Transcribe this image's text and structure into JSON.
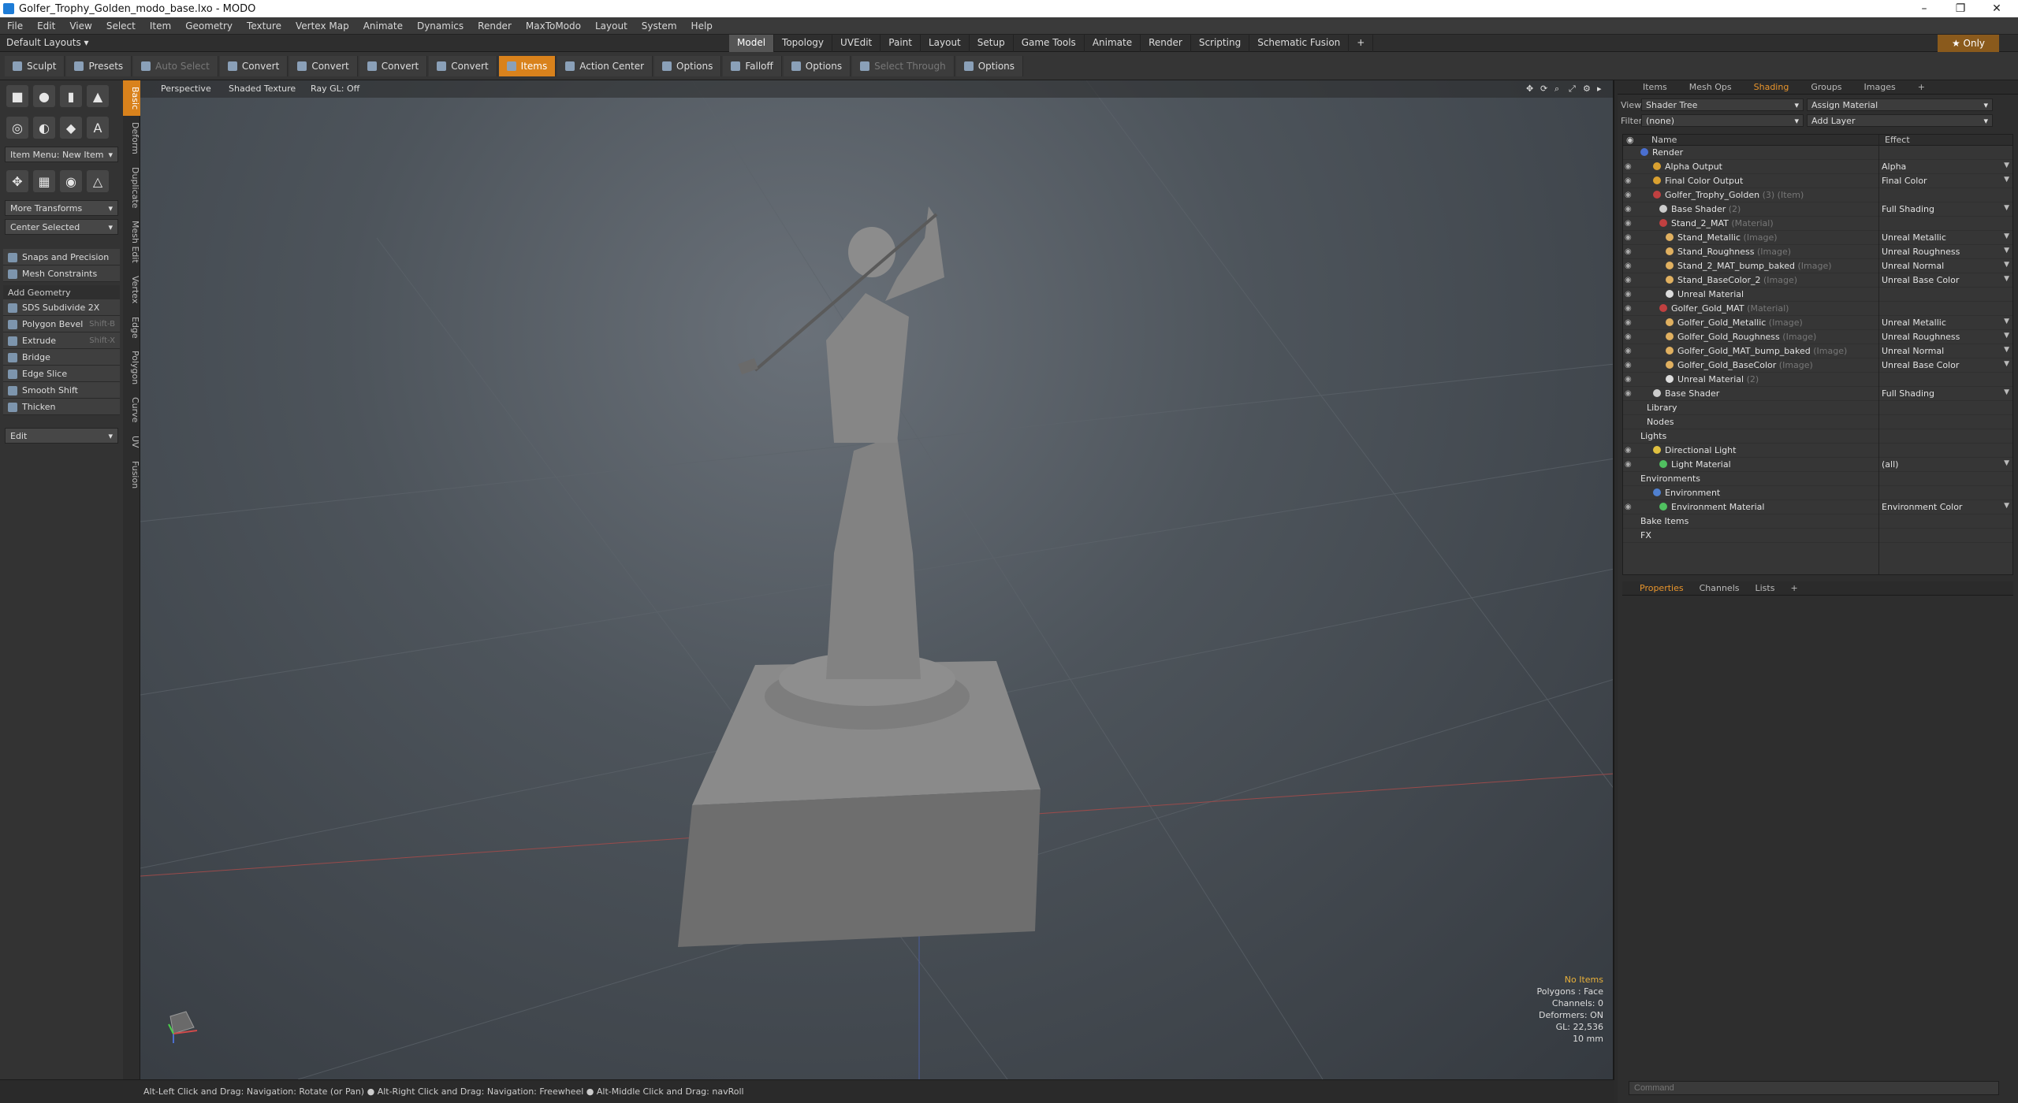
{
  "window": {
    "title": "Golfer_Trophy_Golden_modo_base.lxo - MODO",
    "minimize": "–",
    "maximize": "❐",
    "close": "✕"
  },
  "menu": [
    "File",
    "Edit",
    "View",
    "Select",
    "Item",
    "Geometry",
    "Texture",
    "Vertex Map",
    "Animate",
    "Dynamics",
    "Render",
    "MaxToModo",
    "Layout",
    "System",
    "Help"
  ],
  "layouts": {
    "current": "Default Layouts ▾",
    "tabs": [
      "Model",
      "Topology",
      "UVEdit",
      "Paint",
      "Layout",
      "Setup",
      "Game Tools",
      "Animate",
      "Render",
      "Scripting",
      "Schematic Fusion"
    ],
    "add": "+",
    "only": "★ Only"
  },
  "toolbar": {
    "sculpt": "Sculpt",
    "presets": "Presets",
    "auto_select": "Auto Select",
    "convert1": "Convert",
    "convert2": "Convert",
    "convert3": "Convert",
    "convert4": "Convert",
    "items": "Items",
    "action_center": "Action Center",
    "options1": "Options",
    "falloff": "Falloff",
    "options2": "Options",
    "select_through": "Select Through",
    "options3": "Options"
  },
  "left": {
    "item_menu": "Item Menu: New Item",
    "more_transforms": "More Transforms",
    "center_selected": "Center Selected",
    "snaps": "Snaps and Precision",
    "mesh_constraints": "Mesh Constraints",
    "add_geometry": "Add Geometry",
    "tools": [
      {
        "label": "SDS Subdivide 2X",
        "shortcut": ""
      },
      {
        "label": "Polygon Bevel",
        "shortcut": "Shift-B"
      },
      {
        "label": "Extrude",
        "shortcut": "Shift-X"
      },
      {
        "label": "Bridge",
        "shortcut": ""
      },
      {
        "label": "Edge Slice",
        "shortcut": ""
      },
      {
        "label": "Smooth Shift",
        "shortcut": ""
      },
      {
        "label": "Thicken",
        "shortcut": ""
      }
    ],
    "edit": "Edit",
    "vtabs": [
      "Basic",
      "Deform",
      "Duplicate",
      "Mesh Edit",
      "Vertex",
      "Edge",
      "Polygon",
      "Curve",
      "UV",
      "Fusion"
    ]
  },
  "viewport": {
    "perspective": "Perspective",
    "shading": "Shaded Texture",
    "raygl": "Ray GL: Off",
    "info": [
      "No Items",
      "Polygons : Face",
      "Channels: 0",
      "Deformers: ON",
      "GL: 22,536",
      "10 mm"
    ]
  },
  "status": "Alt-Left Click and Drag: Navigation: Rotate (or Pan) ● Alt-Right Click and Drag: Navigation: Freewheel ● Alt-Middle Click and Drag: navRoll",
  "right": {
    "tabs": [
      "Items",
      "Mesh Ops",
      "Shading",
      "Groups",
      "Images",
      "+"
    ],
    "view_label": "View",
    "view_value": "Shader Tree",
    "assign": "Assign Material",
    "filter_label": "Filter",
    "filter_value": "(none)",
    "add_layer": "Add Layer",
    "col_name": "Name",
    "col_effect": "Effect",
    "tree": [
      {
        "name": "Render",
        "sub": "",
        "effect": "",
        "indent": 0,
        "color": "#4a6fd0",
        "eye": false
      },
      {
        "name": "Alpha Output",
        "sub": "",
        "effect": "Alpha",
        "indent": 2,
        "color": "#d9a030",
        "eye": true
      },
      {
        "name": "Final Color Output",
        "sub": "",
        "effect": "Final Color",
        "indent": 2,
        "color": "#d9a030",
        "eye": true
      },
      {
        "name": "Golfer_Trophy_Golden",
        "sub": "(3) (Item)",
        "effect": "",
        "indent": 2,
        "color": "#c04040",
        "eye": true
      },
      {
        "name": "Base Shader",
        "sub": "(2)",
        "effect": "Full Shading",
        "indent": 3,
        "color": "#cccccc",
        "eye": true
      },
      {
        "name": "Stand_2_MAT",
        "sub": "(Material)",
        "effect": "",
        "indent": 3,
        "color": "#c04040",
        "eye": true
      },
      {
        "name": "Stand_Metallic",
        "sub": "(Image)",
        "effect": "Unreal Metallic",
        "indent": 4,
        "color": "#e0b060",
        "eye": true
      },
      {
        "name": "Stand_Roughness",
        "sub": "(Image)",
        "effect": "Unreal Roughness",
        "indent": 4,
        "color": "#e0b060",
        "eye": true
      },
      {
        "name": "Stand_2_MAT_bump_baked",
        "sub": "(Image)",
        "effect": "Unreal Normal",
        "indent": 4,
        "color": "#e0b060",
        "eye": true
      },
      {
        "name": "Stand_BaseColor_2",
        "sub": "(Image)",
        "effect": "Unreal Base Color",
        "indent": 4,
        "color": "#e0b060",
        "eye": true
      },
      {
        "name": "Unreal Material",
        "sub": "",
        "effect": "",
        "indent": 4,
        "color": "#dddddd",
        "eye": true
      },
      {
        "name": "Golfer_Gold_MAT",
        "sub": "(Material)",
        "effect": "",
        "indent": 3,
        "color": "#c04040",
        "eye": true
      },
      {
        "name": "Golfer_Gold_Metallic",
        "sub": "(Image)",
        "effect": "Unreal Metallic",
        "indent": 4,
        "color": "#e0b060",
        "eye": true
      },
      {
        "name": "Golfer_Gold_Roughness",
        "sub": "(Image)",
        "effect": "Unreal Roughness",
        "indent": 4,
        "color": "#e0b060",
        "eye": true
      },
      {
        "name": "Golfer_Gold_MAT_bump_baked",
        "sub": "(Image)",
        "effect": "Unreal Normal",
        "indent": 4,
        "color": "#e0b060",
        "eye": true
      },
      {
        "name": "Golfer_Gold_BaseColor",
        "sub": "(Image)",
        "effect": "Unreal Base Color",
        "indent": 4,
        "color": "#e0b060",
        "eye": true
      },
      {
        "name": "Unreal Material",
        "sub": "(2)",
        "effect": "",
        "indent": 4,
        "color": "#dddddd",
        "eye": true
      },
      {
        "name": "Base Shader",
        "sub": "",
        "effect": "Full Shading",
        "indent": 2,
        "color": "#cccccc",
        "eye": true
      },
      {
        "name": "Library",
        "sub": "",
        "effect": "",
        "indent": 1,
        "color": "",
        "eye": false
      },
      {
        "name": "Nodes",
        "sub": "",
        "effect": "",
        "indent": 1,
        "color": "",
        "eye": false
      },
      {
        "name": "Lights",
        "sub": "",
        "effect": "",
        "indent": 0,
        "color": "",
        "eye": false
      },
      {
        "name": "Directional Light",
        "sub": "",
        "effect": "",
        "indent": 2,
        "color": "#e0c040",
        "eye": true
      },
      {
        "name": "Light Material",
        "sub": "",
        "effect": "(all)",
        "indent": 3,
        "color": "#50c060",
        "eye": true
      },
      {
        "name": "Environments",
        "sub": "",
        "effect": "",
        "indent": 0,
        "color": "",
        "eye": false
      },
      {
        "name": "Environment",
        "sub": "",
        "effect": "",
        "indent": 2,
        "color": "#5080d0",
        "eye": false
      },
      {
        "name": "Environment Material",
        "sub": "",
        "effect": "Environment Color",
        "indent": 3,
        "color": "#50c060",
        "eye": true
      },
      {
        "name": "Bake Items",
        "sub": "",
        "effect": "",
        "indent": 0,
        "color": "",
        "eye": false
      },
      {
        "name": "FX",
        "sub": "",
        "effect": "",
        "indent": 0,
        "color": "",
        "eye": false
      }
    ],
    "prop_tabs": [
      "Properties",
      "Channels",
      "Lists",
      "+"
    ],
    "command_placeholder": "Command"
  }
}
